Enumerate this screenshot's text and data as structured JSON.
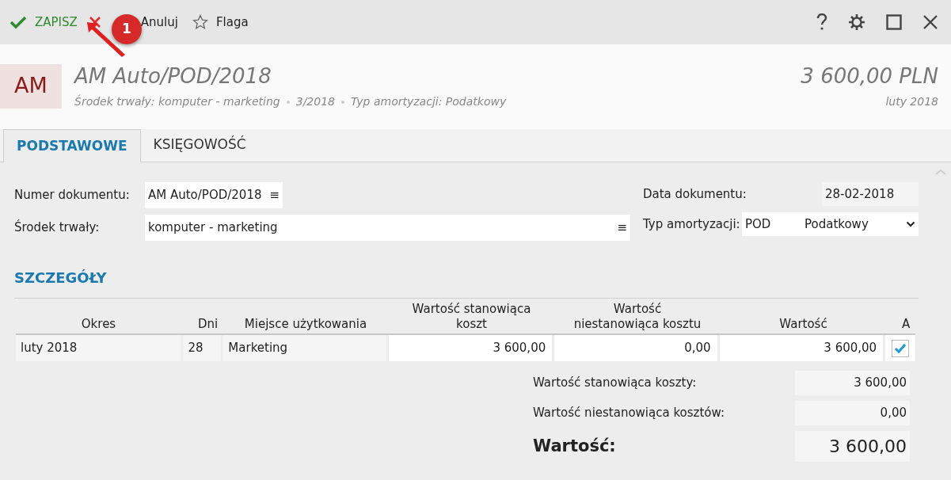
{
  "toolbar": {
    "actions": [
      {
        "kind": "save",
        "label": "ZAPISZ"
      },
      {
        "kind": "cancel",
        "label": "Anuluj"
      },
      {
        "kind": "flag",
        "label": "Flaga"
      }
    ],
    "callout": {
      "number": "1"
    }
  },
  "header": {
    "initials": "AM",
    "title": "AM Auto/POD/2018",
    "meta": [
      "Środek trwały: komputer - marketing",
      "3/2018",
      "Typ amortyzacji: Podatkowy"
    ],
    "amount": "3 600,00 PLN",
    "period": "luty 2018"
  },
  "tabs": [
    {
      "label": "PODSTAWOWE",
      "selected": true
    },
    {
      "label": "KSIĘGOWOŚĆ",
      "selected": false
    }
  ],
  "form": {
    "document_number": {
      "label": "Numer dokumentu:",
      "value": "AM Auto/POD/2018",
      "menu": "≡"
    },
    "fixed_asset": {
      "label": "Środek trwały:",
      "value": "komputer - marketing",
      "menu": "≡"
    },
    "document_date": {
      "label": "Data dokumentu:",
      "value": "28-02-2018"
    },
    "depreciation_type": {
      "label": "Typ amortyzacji:",
      "code": "POD",
      "value": "Podatkowy"
    }
  },
  "details": {
    "title": "SZCZEGÓŁY",
    "columns": [
      "Okres",
      "Dni",
      "Miejsce użytkowania",
      "Wartość stanowiąca koszt",
      "Wartość niestanowiąca kosztu",
      "Wartość",
      "A"
    ],
    "rows": [
      {
        "period": "luty 2018",
        "days": "28",
        "place": "Marketing",
        "cost_value": "3 600,00",
        "non_cost_value": "0,00",
        "value": "3 600,00",
        "checked": true
      }
    ]
  },
  "summary": [
    {
      "label": "Wartość stanowiąca koszty:",
      "value": "3 600,00",
      "total": false
    },
    {
      "label": "Wartość niestanowiąca kosztów:",
      "value": "0,00",
      "total": false
    },
    {
      "label": "Wartość:",
      "value": "3 600,00",
      "total": true
    }
  ]
}
